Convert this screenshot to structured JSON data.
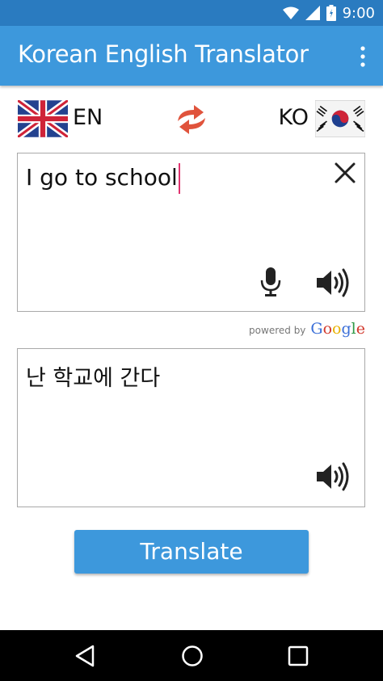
{
  "status_bar": {
    "time": "9:00",
    "icons": [
      "wifi-icon",
      "signal-icon",
      "battery-icon"
    ]
  },
  "app_bar": {
    "title": "Korean English Translator",
    "menu_icon": "overflow-menu-icon"
  },
  "languages": {
    "source_code": "EN",
    "target_code": "KO",
    "source_flag": "uk-flag-icon",
    "target_flag": "south-korea-flag-icon",
    "swap_icon": "swap-icon"
  },
  "input": {
    "text": "I go to school",
    "icons": [
      "clear-icon",
      "microphone-icon",
      "speaker-icon"
    ]
  },
  "powered_by": {
    "label": "powered by",
    "brand": "Google"
  },
  "output": {
    "text": "난 학교에 간다",
    "icons": [
      "speaker-icon"
    ]
  },
  "actions": {
    "translate_label": "Translate"
  },
  "nav_bar": {
    "icons": [
      "back-icon",
      "home-icon",
      "recents-icon"
    ]
  },
  "colors": {
    "status_bar": "#2a7bc0",
    "app_bar": "#3d98dc",
    "button": "#3d98dc",
    "caret": "#e0336f",
    "swap_arrows": "#e0533c"
  }
}
